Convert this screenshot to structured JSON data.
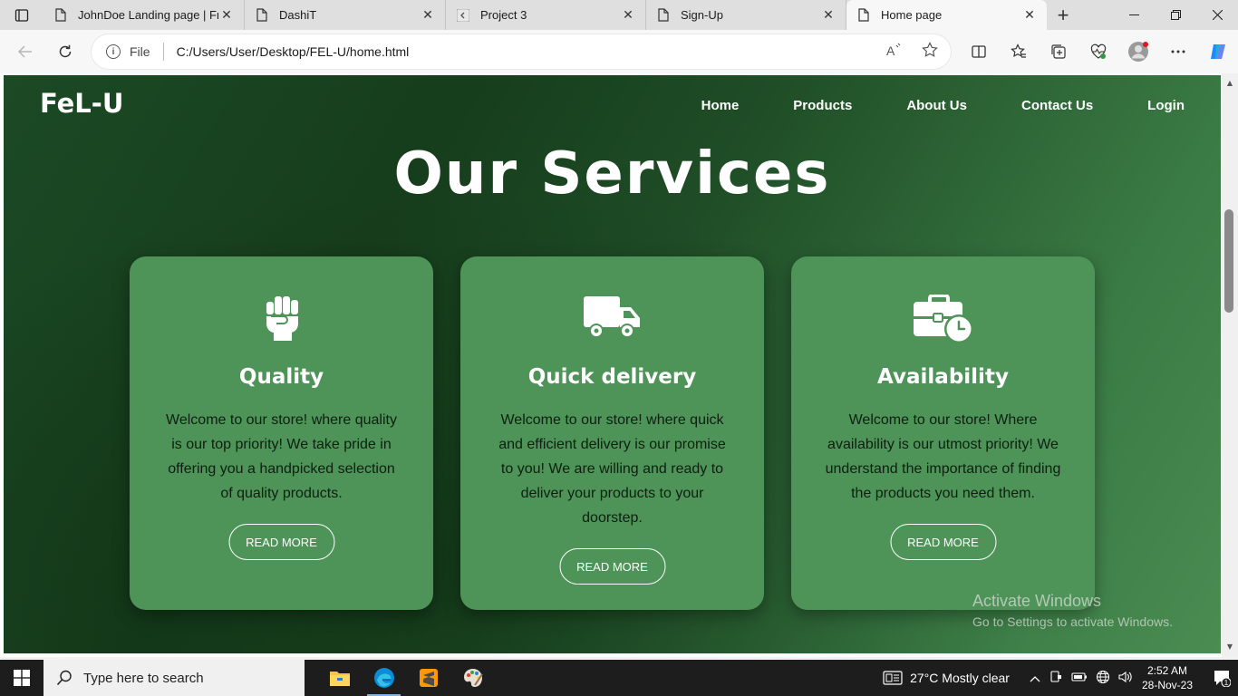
{
  "browser": {
    "tabs": [
      {
        "title": "JohnDoe Landing page | Free",
        "icon": "page-icon",
        "active": false
      },
      {
        "title": "DashiT",
        "icon": "page-icon",
        "active": false
      },
      {
        "title": "Project 3",
        "icon": "site-icon",
        "active": false
      },
      {
        "title": "Sign-Up",
        "icon": "page-icon",
        "active": false
      },
      {
        "title": "Home page",
        "icon": "page-icon",
        "active": true
      }
    ],
    "address": {
      "file_label": "File",
      "url": "C:/Users/User/Desktop/FEL-U/home.html"
    }
  },
  "site": {
    "logo": "FeL-U",
    "nav": [
      "Home",
      "Products",
      "About Us",
      "Contact Us",
      "Login"
    ],
    "section_title": "Our Services",
    "cards": [
      {
        "icon": "fist-icon",
        "title": "Quality",
        "text": "Welcome to our store! where quality is our top priority! We take pride in offering you a handpicked selection of quality products.",
        "button": "READ MORE"
      },
      {
        "icon": "truck-icon",
        "title": "Quick delivery",
        "text": "Welcome to our store! where quick and efficient delivery is our promise to you! We are willing and ready to deliver your products to your doorstep.",
        "button": "READ MORE"
      },
      {
        "icon": "briefcase-clock-icon",
        "title": "Availability",
        "text": "Welcome to our store! Where availability is our utmost priority! We understand the importance of finding the products you need them.",
        "button": "READ MORE"
      }
    ]
  },
  "watermark": {
    "line1": "Activate Windows",
    "line2": "Go to Settings to activate Windows."
  },
  "taskbar": {
    "search_placeholder": "Type here to search",
    "weather": "27°C  Mostly clear",
    "time": "2:52 AM",
    "date": "28-Nov-23",
    "notification_count": "1"
  },
  "colors": {
    "card_bg": "#4e9458",
    "page_dark": "#163d1c",
    "page_light": "#4a8c52"
  }
}
